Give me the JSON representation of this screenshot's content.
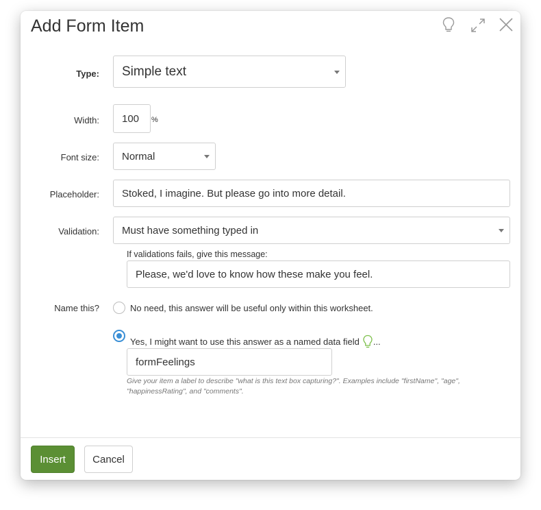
{
  "dialog": {
    "title": "Add Form Item",
    "icons": [
      "lightbulb-icon",
      "expand-icon",
      "close-icon"
    ]
  },
  "form": {
    "type": {
      "label": "Type:",
      "value": "Simple text"
    },
    "width": {
      "label": "Width:",
      "value": "100",
      "unit": "%"
    },
    "font_size": {
      "label": "Font size:",
      "value": "Normal"
    },
    "placeholder": {
      "label": "Placeholder:",
      "value": "Stoked, I imagine. But please go into more detail."
    },
    "validation": {
      "label": "Validation:",
      "value": "Must have something typed in",
      "message_label": "If validations fails, give this message:",
      "message_value": "Please, we'd love to know how these make you feel."
    },
    "name_this": {
      "label": "Name this?",
      "option_no": "No need, this answer will be useful only within this worksheet.",
      "option_yes": "Yes, I might want to use this answer as a named data field",
      "option_yes_suffix": "...",
      "selected": "yes",
      "field_value": "formFeelings",
      "hint": "Give your item a label to describe \"what is this text box capturing?\". Examples include \"firstName\", \"age\", \"happinessRating\", and \"comments\"."
    }
  },
  "footer": {
    "insert_label": "Insert",
    "cancel_label": "Cancel"
  },
  "colors": {
    "primary_button": "#5b8f34",
    "radio_selected": "#3a8fd6",
    "hint_bulb": "#7cbf4a"
  }
}
